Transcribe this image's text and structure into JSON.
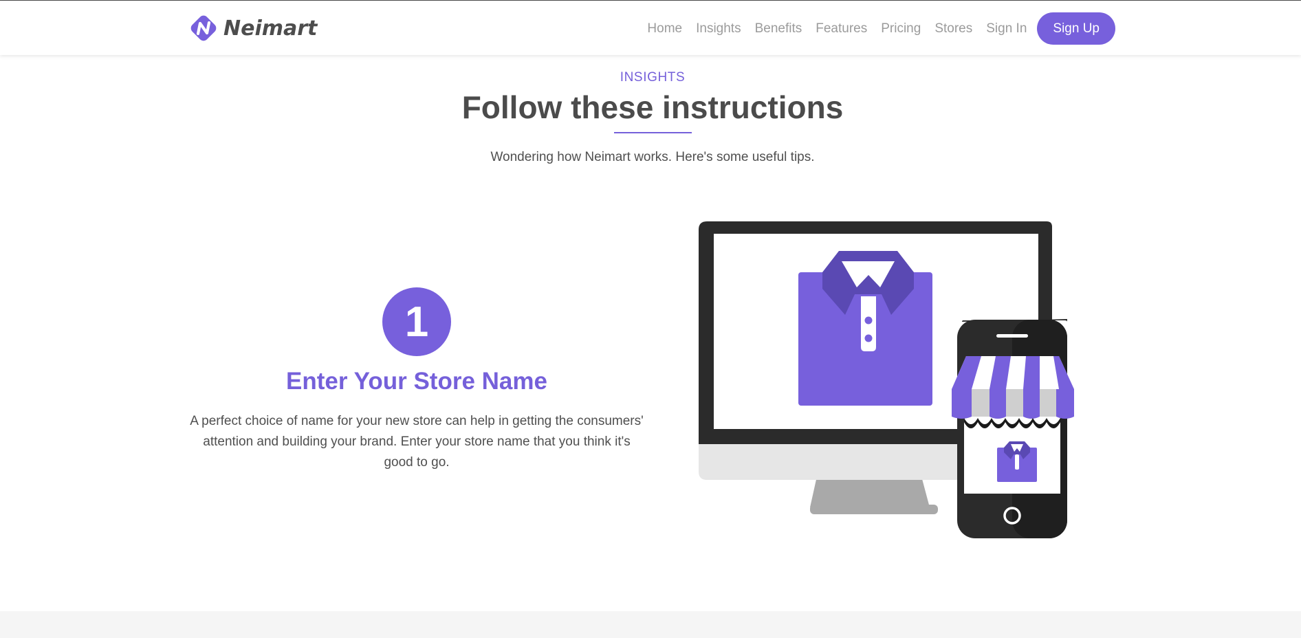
{
  "brand": {
    "name": "Neimart",
    "logo_icon": "neimart-logo-icon"
  },
  "nav": {
    "items": [
      {
        "label": "Home"
      },
      {
        "label": "Insights"
      },
      {
        "label": "Benefits"
      },
      {
        "label": "Features"
      },
      {
        "label": "Pricing"
      },
      {
        "label": "Stores"
      },
      {
        "label": "Sign In"
      }
    ],
    "cta_label": "Sign Up"
  },
  "section": {
    "eyebrow": "INSIGHTS",
    "title": "Follow these instructions",
    "subtitle": "Wondering how Neimart works. Here's some useful tips."
  },
  "step": {
    "number": "1",
    "title": "Enter Your Store Name",
    "text": "A perfect choice of name for your new store can help in getting the consumers' attention and building your brand. Enter your store name that you think it's good to go."
  },
  "illustration": {
    "icon": "desktop-and-phone-store-icon"
  },
  "colors": {
    "accent": "#7760dc",
    "accent_dark": "#5a49b3",
    "text": "#4b4b4b",
    "nav_text": "#9b9b9b",
    "device_dark": "#2b2b2b"
  }
}
